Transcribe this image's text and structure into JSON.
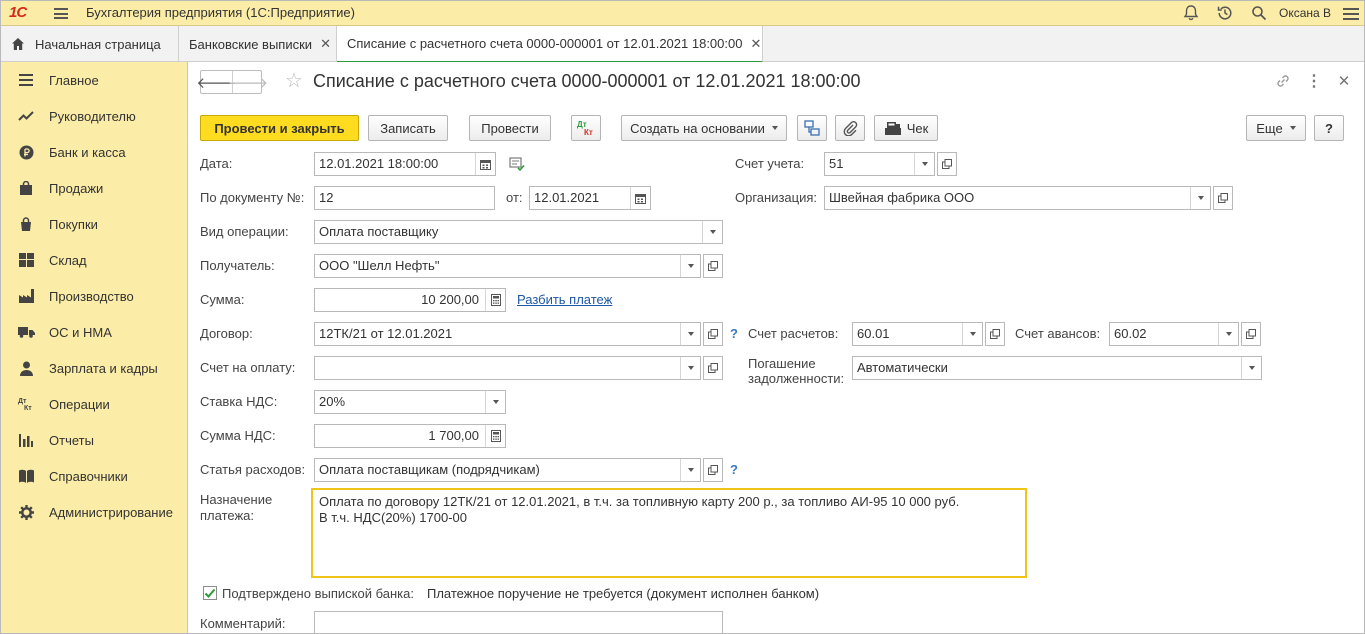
{
  "app": {
    "logo_text": "1С",
    "title": "Бухгалтерия предприятия  (1С:Предприятие)",
    "user": "Оксана В"
  },
  "tabs": [
    {
      "label": "Начальная страница",
      "icon": "home-icon",
      "closable": false,
      "active": false
    },
    {
      "label": "Банковские выписки",
      "icon": null,
      "closable": true,
      "active": false
    },
    {
      "label": "Списание с расчетного счета 0000-000001 от 12.01.2021 18:00:00",
      "icon": null,
      "closable": true,
      "active": true
    }
  ],
  "sidebar": {
    "items": [
      {
        "label": "Главное",
        "icon": "menu-lines-icon"
      },
      {
        "label": "Руководителю",
        "icon": "trend-chart-icon"
      },
      {
        "label": "Банк и касса",
        "icon": "ruble-coin-icon"
      },
      {
        "label": "Продажи",
        "icon": "shopping-bag-icon"
      },
      {
        "label": "Покупки",
        "icon": "cart-bag-icon"
      },
      {
        "label": "Склад",
        "icon": "warehouse-grid-icon"
      },
      {
        "label": "Производство",
        "icon": "factory-icon"
      },
      {
        "label": "ОС и НМА",
        "icon": "truck-icon"
      },
      {
        "label": "Зарплата и кадры",
        "icon": "person-icon"
      },
      {
        "label": "Операции",
        "icon": "dt-kt-icon"
      },
      {
        "label": "Отчеты",
        "icon": "bar-chart-icon"
      },
      {
        "label": "Справочники",
        "icon": "book-icon"
      },
      {
        "label": "Администрирование",
        "icon": "gear-icon"
      }
    ]
  },
  "document": {
    "title": "Списание с расчетного счета 0000-000001 от 12.01.2021 18:00:00"
  },
  "toolbar": {
    "post_close": "Провести и закрыть",
    "save": "Записать",
    "post": "Провести",
    "dtkt_label": "Дт Кт",
    "create_based": "Создать на основании",
    "receipt": "Чек",
    "more": "Еще",
    "help": "?"
  },
  "form": {
    "date": {
      "label": "Дата:",
      "value": "12.01.2021 18:00:00"
    },
    "doc_no": {
      "label": "По документу №:",
      "value": "12",
      "from_label": "от:",
      "from_value": "12.01.2021"
    },
    "account": {
      "label": "Счет учета:",
      "value": "51"
    },
    "organization": {
      "label": "Организация:",
      "value": "Швейная фабрика ООО"
    },
    "operation": {
      "label": "Вид операции:",
      "value": "Оплата поставщику"
    },
    "recipient": {
      "label": "Получатель:",
      "value": "ООО \"Шелл Нефть\""
    },
    "amount": {
      "label": "Сумма:",
      "value": "10 200,00",
      "split_link": "Разбить платеж"
    },
    "contract": {
      "label": "Договор:",
      "value": "12ТК/21 от 12.01.2021"
    },
    "settlement_account": {
      "label": "Счет расчетов:",
      "value": "60.01"
    },
    "advance_account": {
      "label": "Счет авансов:",
      "value": "60.02"
    },
    "invoice": {
      "label": "Счет на оплату:",
      "value": ""
    },
    "debt_repayment": {
      "label_line1": "Погашение",
      "label_line2": "задолженности:",
      "value": "Автоматически"
    },
    "vat_rate": {
      "label": "Ставка НДС:",
      "value": "20%"
    },
    "vat_amount": {
      "label": "Сумма НДС:",
      "value": "1 700,00"
    },
    "expense_item": {
      "label": "Статья расходов:",
      "value": "Оплата поставщикам (подрядчикам)"
    },
    "purpose": {
      "label_line1": "Назначение",
      "label_line2": "платежа:",
      "line1": "Оплата по договору 12ТК/21 от 12.01.2021, в т.ч. за топливную карту 200 р., за топливо АИ-95 10 000 руб.",
      "line2": "В т.ч. НДС(20%) 1700-00"
    },
    "confirmed": {
      "label": "Подтверждено выпиской банка:",
      "checked": true,
      "note": "Платежное поручение не требуется (документ исполнен банком)"
    },
    "comment": {
      "label": "Комментарий:",
      "value": ""
    }
  },
  "colors": {
    "accent_yellow": "#ffdc1f",
    "panel_yellow": "#fbeda7",
    "active_tab_green": "#2f9a3b",
    "link_blue": "#1d57a5",
    "focus_border": "#f0c419"
  }
}
